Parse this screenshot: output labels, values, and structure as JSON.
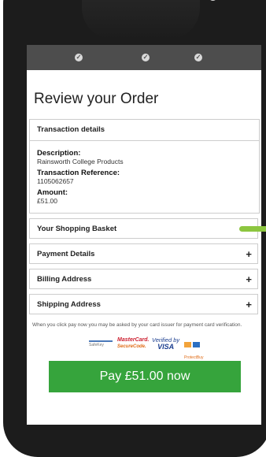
{
  "status_bar": {
    "dots": [
      "check-icon",
      "check-icon",
      "check-icon"
    ]
  },
  "page": {
    "title": "Review your Order"
  },
  "transaction": {
    "header": "Transaction details",
    "description_label": "Description:",
    "description_value": "Rainsworth College Products",
    "reference_label": "Transaction Reference:",
    "reference_value": "1105062657",
    "amount_label": "Amount:",
    "amount_value": "£51.00"
  },
  "sections": {
    "basket": "Your Shopping Basket",
    "payment": "Payment Details",
    "billing": "Billing Address",
    "shipping": "Shipping Address",
    "expand_symbol": "+"
  },
  "note": "When you click pay now you may be asked by your card issuer for payment card verification.",
  "badges": {
    "safekey": "SafeKey",
    "mastercard": "MasterCard.",
    "mastercard_sub": "SecureCode.",
    "verified_by": "Verified by",
    "visa": "VISA",
    "protectbuy": "ProtectBuy"
  },
  "pay_button": "Pay £51.00 now",
  "colors": {
    "accent": "#36a43c",
    "status_bar": "#4d4d4d",
    "tab": "#8cc63f"
  }
}
